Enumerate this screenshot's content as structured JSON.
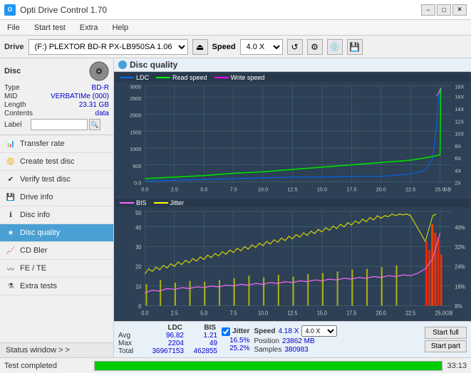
{
  "titlebar": {
    "title": "Opti Drive Control 1.70",
    "icon_text": "O",
    "minimize": "−",
    "maximize": "□",
    "close": "✕"
  },
  "menubar": {
    "items": [
      "File",
      "Start test",
      "Extra",
      "Help"
    ]
  },
  "toolbar": {
    "drive_label": "Drive",
    "drive_value": "(F:)  PLEXTOR BD-R  PX-LB950SA 1.06",
    "speed_label": "Speed",
    "speed_value": "4.0 X"
  },
  "disc": {
    "title": "Disc",
    "type_label": "Type",
    "type_value": "BD-R",
    "mid_label": "MID",
    "mid_value": "VERBATIMe (000)",
    "length_label": "Length",
    "length_value": "23.31 GB",
    "contents_label": "Contents",
    "contents_value": "data",
    "label_label": "Label",
    "label_value": ""
  },
  "sidebar": {
    "items": [
      {
        "id": "transfer-rate",
        "label": "Transfer rate",
        "active": false
      },
      {
        "id": "create-test-disc",
        "label": "Create test disc",
        "active": false
      },
      {
        "id": "verify-test-disc",
        "label": "Verify test disc",
        "active": false
      },
      {
        "id": "drive-info",
        "label": "Drive info",
        "active": false
      },
      {
        "id": "disc-info",
        "label": "Disc info",
        "active": false
      },
      {
        "id": "disc-quality",
        "label": "Disc quality",
        "active": true
      },
      {
        "id": "cd-bler",
        "label": "CD Bler",
        "active": false
      },
      {
        "id": "fe-te",
        "label": "FE / TE",
        "active": false
      },
      {
        "id": "extra-tests",
        "label": "Extra tests",
        "active": false
      }
    ],
    "status_window": "Status window > >"
  },
  "chart": {
    "title": "Disc quality",
    "legend1": {
      "ldc_label": "LDC",
      "read_label": "Read speed",
      "write_label": "Write speed"
    },
    "legend2": {
      "bis_label": "BIS",
      "jitter_label": "Jitter"
    },
    "x_labels": [
      "0.0",
      "2.5",
      "5.0",
      "7.5",
      "10.0",
      "12.5",
      "15.0",
      "17.5",
      "20.0",
      "22.5",
      "25.0"
    ],
    "y1_labels_left": [
      "3000",
      "2500",
      "2000",
      "1500",
      "1000",
      "500",
      "0.0"
    ],
    "y1_labels_right": [
      "18X",
      "16X",
      "14X",
      "12X",
      "10X",
      "8X",
      "6X",
      "4X",
      "2X"
    ],
    "y2_labels_left": [
      "50",
      "40",
      "30",
      "20",
      "10"
    ],
    "y2_labels_right": [
      "40%",
      "32%",
      "24%",
      "16%",
      "8%"
    ],
    "unit": "GB"
  },
  "stats": {
    "ldc_header": "LDC",
    "bis_header": "BIS",
    "jitter_header": "Jitter",
    "speed_header": "Speed",
    "speed_value": "4.18 X",
    "speed_value_blue": "4.0 X",
    "avg_label": "Avg",
    "ldc_avg": "96.82",
    "bis_avg": "1.21",
    "jitter_avg": "16.5%",
    "max_label": "Max",
    "ldc_max": "2204",
    "bis_max": "49",
    "jitter_max": "25.2%",
    "position_label": "Position",
    "position_value": "23862 MB",
    "total_label": "Total",
    "ldc_total": "36967153",
    "bis_total": "462855",
    "samples_label": "Samples",
    "samples_value": "380983",
    "start_full_btn": "Start full",
    "start_part_btn": "Start part"
  },
  "statusbar": {
    "status_text": "Test completed",
    "progress": 100,
    "time": "33:13"
  },
  "colors": {
    "ldc_line": "#0080ff",
    "read_speed_line": "#00ff00",
    "write_speed_line": "#ff00ff",
    "bis_line": "#ff00ff",
    "jitter_line": "#ffff00",
    "jitter_red": "#ff0000",
    "accent": "#4a9fd4",
    "sidebar_active_bg": "#4a9fd4"
  }
}
